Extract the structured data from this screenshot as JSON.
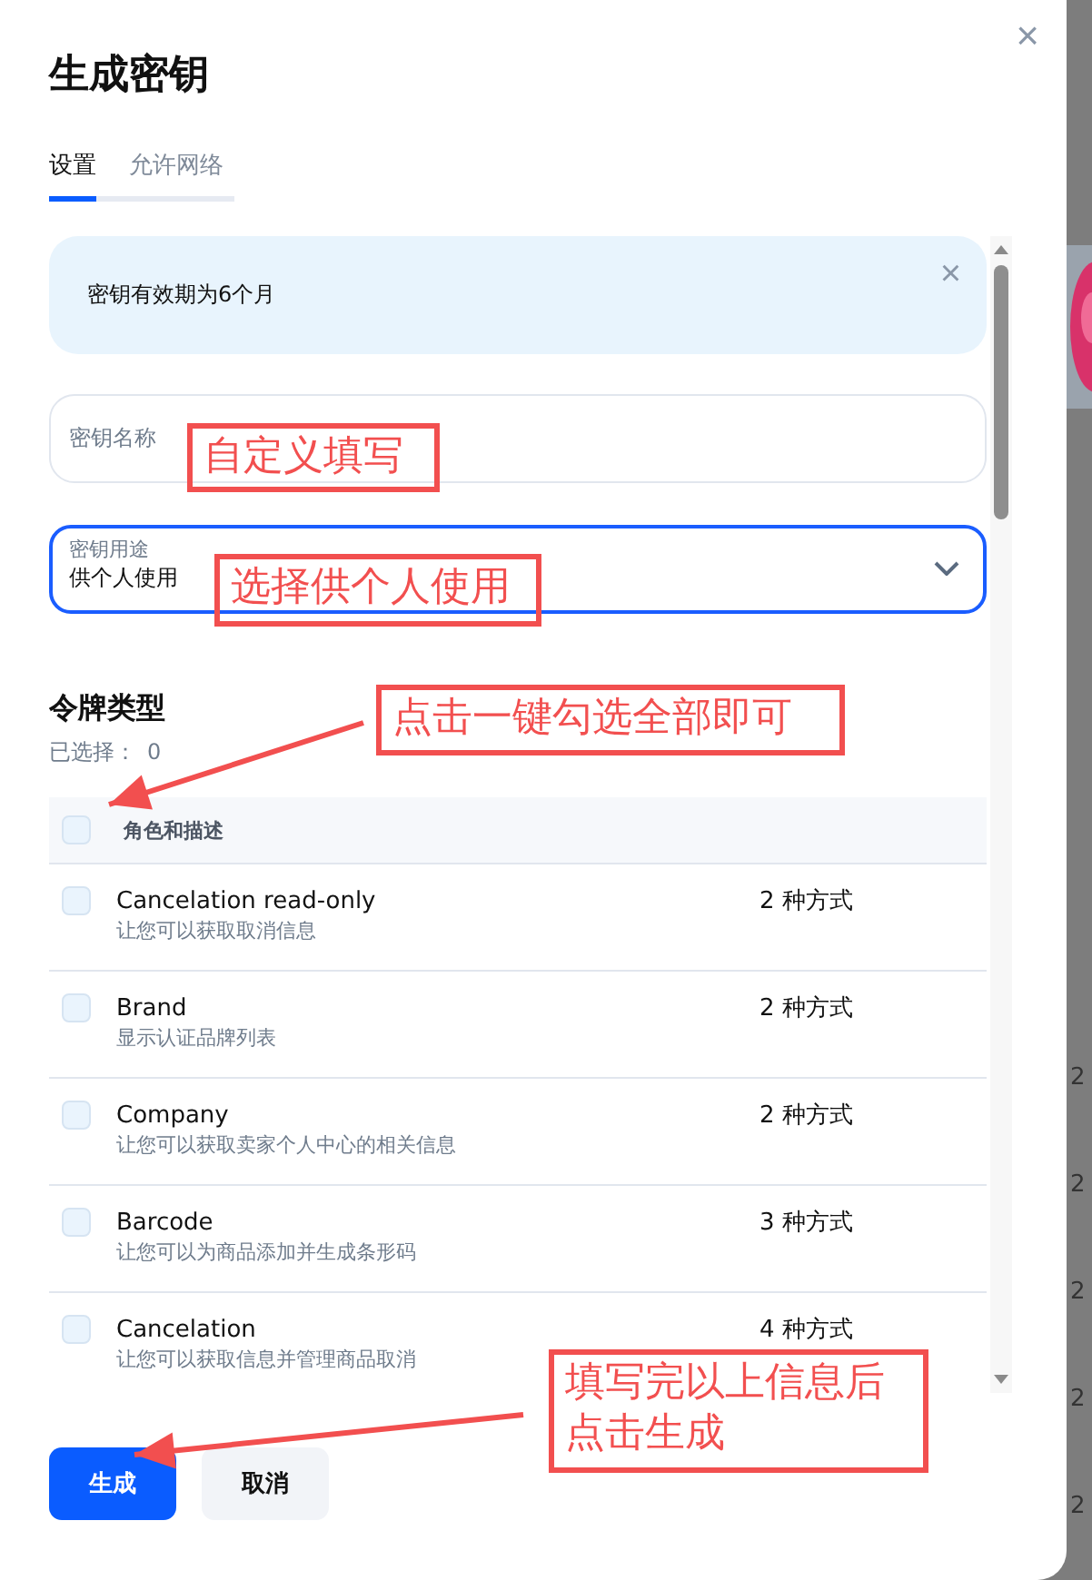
{
  "dialog": {
    "title": "生成密钥",
    "close": "×"
  },
  "tabs": [
    {
      "label": "设置",
      "selected": true
    },
    {
      "label": "允许网络",
      "selected": false
    }
  ],
  "alert": {
    "text": "密钥有效期为6个月",
    "close": "×"
  },
  "name_field": {
    "label": "密钥名称"
  },
  "usage_select": {
    "label": "密钥用途",
    "value": "供个人使用",
    "expanded": false
  },
  "token_types": {
    "title": "令牌类型",
    "selected_label": "已选择：",
    "selected_count": "0",
    "header": {
      "label": "角色和描述",
      "checked": false
    },
    "rows": [
      {
        "name": "Cancelation read-only",
        "description": "让您可以获取取消信息",
        "methods": "2 种方式",
        "checked": false
      },
      {
        "name": "Brand",
        "description": "显示认证品牌列表",
        "methods": "2 种方式",
        "checked": false
      },
      {
        "name": "Company",
        "description": "让您可以获取卖家个人中心的相关信息",
        "methods": "2 种方式",
        "checked": false
      },
      {
        "name": "Barcode",
        "description": "让您可以为商品添加并生成条形码",
        "methods": "3 种方式",
        "checked": false
      },
      {
        "name": "Cancelation",
        "description": "让您可以获取信息并管理商品取消",
        "methods": "4 种方式",
        "checked": false
      }
    ]
  },
  "buttons": [
    {
      "label": "生成",
      "kind": "primary"
    },
    {
      "label": "取消",
      "kind": "secondary"
    }
  ],
  "background_cells": [
    "2",
    "2",
    "2",
    "2",
    "2"
  ],
  "annotations": [
    {
      "text": "自定义填写"
    },
    {
      "text": "选择供个人使用"
    },
    {
      "text": "点击一键勾选全部即可"
    },
    {
      "text": "填写完以上信息后点击生成"
    }
  ]
}
